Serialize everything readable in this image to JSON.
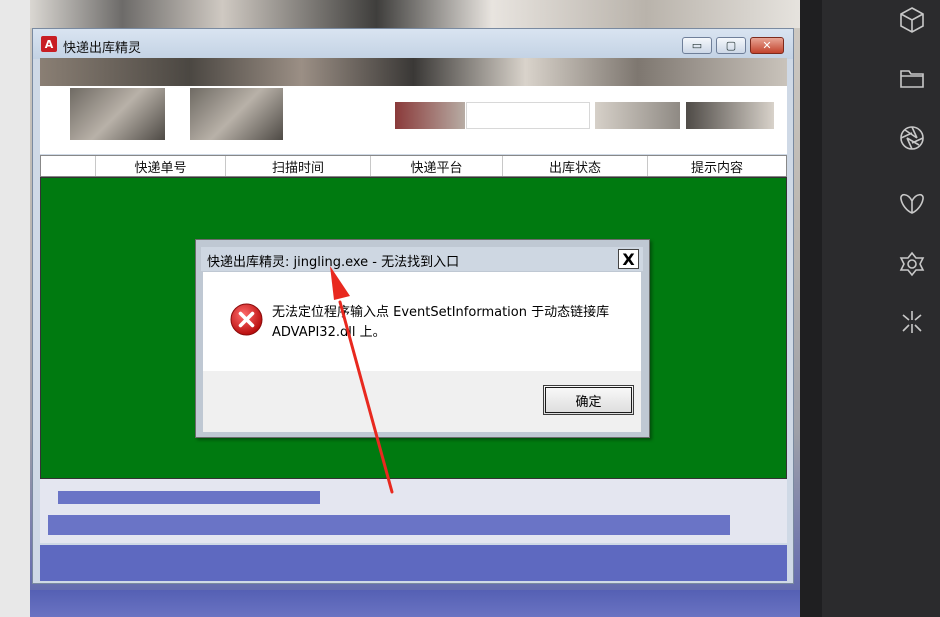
{
  "app": {
    "title": "快递出库精灵",
    "icon_letter": "A",
    "controls": {
      "minimize": "▭",
      "maximize": "▢",
      "close": "✕"
    }
  },
  "table": {
    "columns": [
      "快递单号",
      "扫描时间",
      "快递平台",
      "出库状态",
      "提示内容"
    ],
    "body_color": "#007a10"
  },
  "dialog": {
    "title": "快递出库精灵: jingling.exe - 无法找到入口",
    "close_label": "X",
    "message_line1": "无法定位程序输入点 EventSetInformation 于动态链接库",
    "message_line2": "ADVAPI32.dll 上。",
    "ok_label": "确定"
  },
  "sidebar": {
    "icons": [
      "cube-icon",
      "folder-icon",
      "aperture-icon",
      "butterfly-icon",
      "flower-icon",
      "sparkle-icon"
    ]
  },
  "colors": {
    "annotation_arrow": "#e8291f",
    "status_bar": "#6a74c6",
    "error_icon": "#d32020"
  }
}
